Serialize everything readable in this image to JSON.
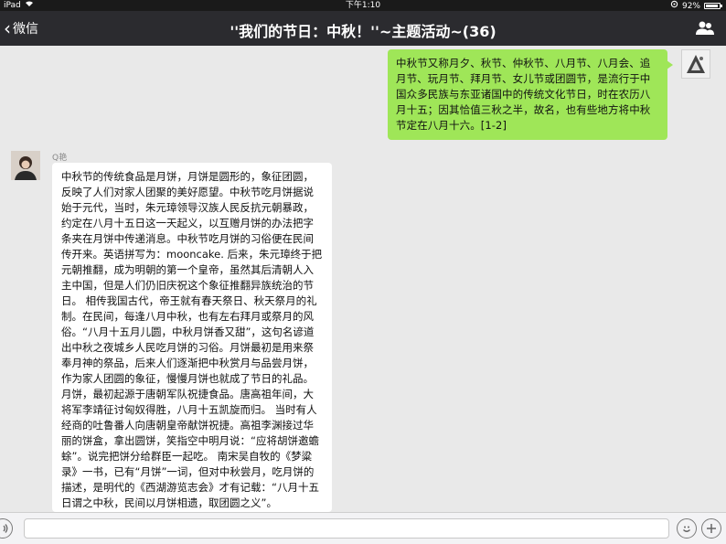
{
  "status_bar": {
    "device": "iPad",
    "time": "下午1:10",
    "battery": "92%",
    "battery_level": 0.92
  },
  "nav": {
    "back_label": "微信",
    "title": "''我们的节日：中秋！''~主题活动~(36)",
    "members_icon": "people-icon"
  },
  "messages": [
    {
      "side": "right",
      "text": "中秋节又称月夕、秋节、仲秋节、八月节、八月会、追月节、玩月节、拜月节、女儿节或团圆节，是流行于中国众多民族与东亚诸国中的传统文化节日，时在农历八月十五；因其恰值三秋之半，故名，也有些地方将中秋节定在八月十六。[1-2]"
    },
    {
      "side": "left",
      "sender": "Q艳",
      "text": "中秋节的传统食品是月饼，月饼是圆形的，象征团圆，反映了人们对家人团聚的美好愿望。中秋节吃月饼据说始于元代，当时，朱元璋领导汉族人民反抗元朝暴政，约定在八月十五日这一天起义，以互赠月饼的办法把字条夹在月饼中传递消息。中秋节吃月饼的习俗便在民间传开来。英语拼写为：mooncake. 后来，朱元璋终于把元朝推翻，成为明朝的第一个皇帝，虽然其后清朝人入主中国，但是人们仍旧庆祝这个象征推翻异族统治的节日。 相传我国古代，帝王就有春天祭日、秋天祭月的礼制。在民间，每逢八月中秋，也有左右拜月或祭月的风俗。“八月十五月儿圆，中秋月饼香又甜”，这句名谚道出中秋之夜城乡人民吃月饼的习俗。月饼最初是用来祭奉月神的祭品，后来人们逐渐把中秋赏月与品尝月饼，作为家人团圆的象征，慢慢月饼也就成了节日的礼品。 月饼，最初起源于唐朝军队祝捷食品。唐高祖年间，大将军李靖征讨匈奴得胜，八月十五凯旋而归。 当时有人经商的吐鲁番人向唐朝皇帝献饼祝捷。高祖李渊接过华丽的饼盒，拿出圆饼，笑指空中明月说：“应将胡饼邀蟾蜍”。说完把饼分给群臣一起吃。 南宋吴自牧的《梦粱录》一书，已有“月饼”一词，但对中秋尝月，吃月饼的描述，是明代的《西湖游览志会》才有记载：“八月十五日谓之中秋，民间以月饼相遗，取团圆之义”。"
    }
  ],
  "input_bar": {
    "voice_icon": "voice-icon",
    "emoji_icon": "emoji-icon",
    "plus_icon": "plus-icon",
    "text_value": ""
  }
}
